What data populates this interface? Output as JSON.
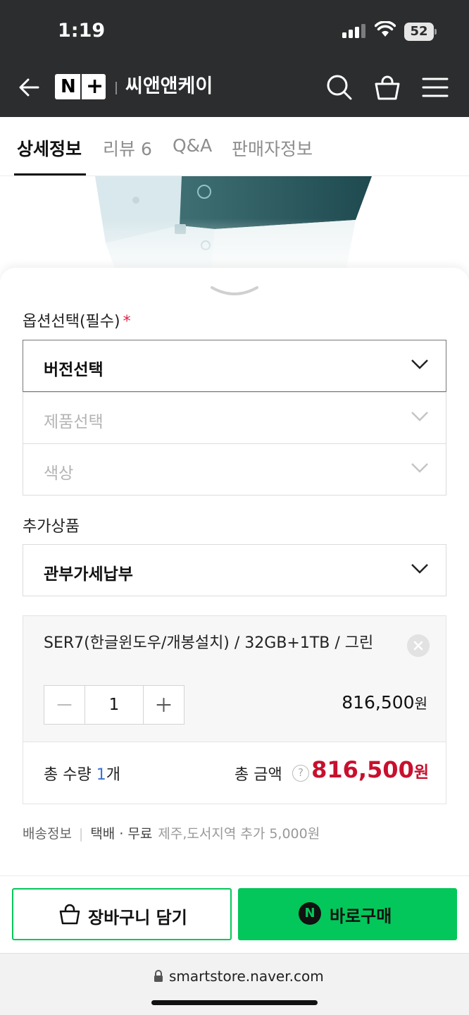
{
  "status_bar": {
    "time": "1:19",
    "battery": "52"
  },
  "header": {
    "store_name": "씨앤앤케이",
    "logo_letter": "N",
    "logo_plus": "+"
  },
  "tabs": [
    {
      "label": "상세정보",
      "active": true
    },
    {
      "label": "리뷰 6",
      "active": false
    },
    {
      "label": "Q&A",
      "active": false
    },
    {
      "label": "판매자정보",
      "active": false
    }
  ],
  "options": {
    "required_label": "옵션선택(필수)",
    "required_mark": "*",
    "selects": [
      {
        "label": "버전선택",
        "enabled": true
      },
      {
        "label": "제품선택",
        "enabled": false
      },
      {
        "label": "색상",
        "enabled": false
      }
    ],
    "extra_label": "추가상품",
    "extra_select": "관부가세납부"
  },
  "selected_item": {
    "name": "SER7(한글윈도우/개봉설치) / 32GB+1TB / 그린",
    "quantity": "1",
    "price": "816,500",
    "currency": "원"
  },
  "total": {
    "qty_prefix": "총 수량 ",
    "qty_value": "1",
    "qty_suffix": "개",
    "amount_label": "총 금액",
    "help": "?",
    "amount": "816,500",
    "currency": "원"
  },
  "delivery": {
    "label": "배송정보",
    "method": "택배 · 무료",
    "note": "제주,도서지역 추가 5,000원"
  },
  "buttons": {
    "cart": "장바구니 담기",
    "buy": "바로구매",
    "buy_badge": "N"
  },
  "browser": {
    "url": "smartstore.naver.com"
  },
  "colors": {
    "primary_green": "#03c75a",
    "price_red": "#c8102e",
    "header_dark": "#2b2d2e"
  }
}
